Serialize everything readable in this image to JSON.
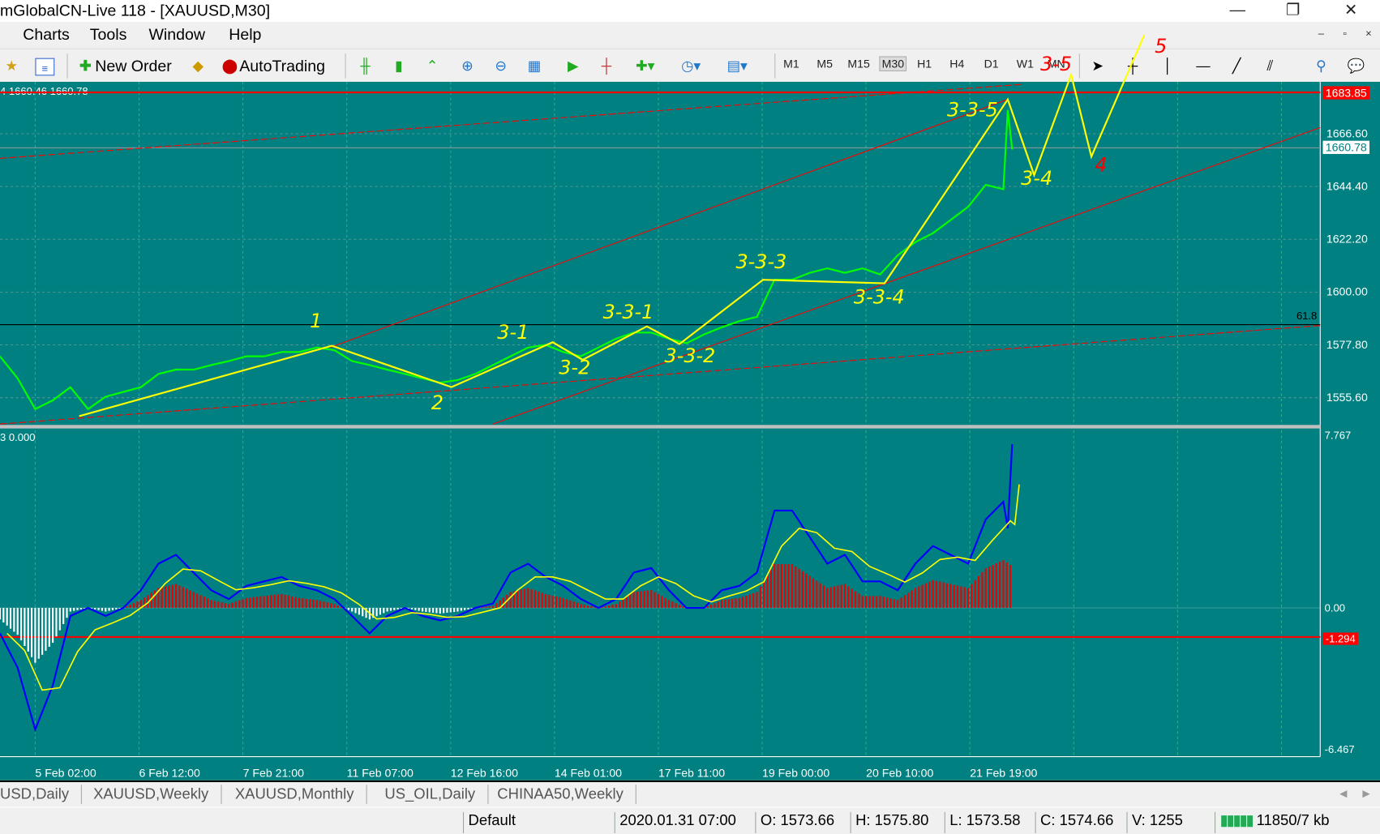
{
  "window": {
    "title": "mGlobalCN-Live 118 - [XAUUSD,M30]",
    "minimize": "—",
    "restore": "❐",
    "close": "✕"
  },
  "menu": [
    "Charts",
    "Tools",
    "Window",
    "Help"
  ],
  "mdi_buttons": [
    "–",
    "▫",
    "×"
  ],
  "toolbar": {
    "new_order": "New Order",
    "autotrading": "AutoTrading",
    "timeframes": [
      "M1",
      "M5",
      "M15",
      "M30",
      "H1",
      "H4",
      "D1",
      "W1",
      "MN"
    ],
    "active_timeframe": "M30"
  },
  "chart": {
    "info": "4 1660.46 1660.78",
    "price_axis": [
      "1666.60",
      "1644.40",
      "1622.20",
      "1600.00",
      "1577.80",
      "1555.60"
    ],
    "resistance_label": "1683.85",
    "bid_label": "1660.78",
    "fib_label": "61.8",
    "indicator_info": "3 0.000",
    "indicator_axis": {
      "top": "7.767",
      "zero": "0.00",
      "bottom": "-6.467",
      "level": "-1.294"
    },
    "time_axis": [
      "5 Feb 02:00",
      "6 Feb 12:00",
      "7 Feb 21:00",
      "11 Feb 07:00",
      "12 Feb 16:00",
      "14 Feb 01:00",
      "17 Feb 11:00",
      "19 Feb 00:00",
      "20 Feb 10:00",
      "21 Feb 19:00"
    ],
    "annotations": [
      "1",
      "2",
      "3-1",
      "3-2",
      "3-3-1",
      "3-3-2",
      "3-3-3",
      "3-3-4",
      "3-3-5",
      "3-4",
      "4",
      "5",
      "3-5"
    ],
    "colors": {
      "bg": "#008080",
      "price": "#00ff00",
      "wave": "#ffff00",
      "trend": "#ff0000",
      "macd": "#0000ff",
      "signal": "#ffff00"
    }
  },
  "chart_data": {
    "type": "line",
    "symbol": "XAUUSD",
    "timeframe": "M30",
    "price_series": [
      1573,
      1563.7,
      1550.8,
      1554.5,
      1560,
      1550.8,
      1556,
      1558,
      1560,
      1565.6,
      1567.4,
      1567.4,
      1569.3,
      1571,
      1573,
      1573,
      1574.8,
      1574.8,
      1576.7,
      1575.6,
      1571,
      1569.3,
      1567.4,
      1565.6,
      1563.7,
      1561.9,
      1563,
      1565.6,
      1569.3,
      1573,
      1576.7,
      1577.8,
      1574.8,
      1573,
      1576.7,
      1580.4,
      1583,
      1583,
      1580.4,
      1578.5,
      1582.2,
      1585.2,
      1587.8,
      1589.6,
      1605.2,
      1605.2,
      1608.1,
      1610,
      1608.1,
      1610,
      1607.4,
      1615.5,
      1621,
      1624.8,
      1630.3,
      1635.9,
      1645.1,
      1643.3,
      1676.6,
      1660
    ],
    "macd_series": [
      -1.15,
      -2.7,
      -5.5,
      -3.5,
      -0.36,
      0,
      -0.36,
      0,
      0.8,
      2.0,
      2.4,
      1.6,
      0.8,
      0.4,
      1.0,
      1.2,
      1.4,
      1.0,
      0.8,
      0.4,
      -0.36,
      -1.15,
      -0.36,
      0,
      -0.36,
      -0.56,
      -0.36,
      0,
      0.2,
      1.6,
      2.0,
      1.4,
      1.0,
      0.4,
      0,
      0.4,
      1.6,
      1.8,
      0.8,
      0,
      0,
      0.8,
      1.0,
      1.6,
      4.4,
      4.4,
      3.2,
      2.0,
      2.4,
      1.2,
      1.2,
      0.8,
      2.0,
      2.8,
      2.4,
      2.0,
      4.0,
      4.8,
      3.6,
      7.4
    ],
    "ylim_price": [
      1550,
      1690
    ],
    "ylim_macd": [
      -6.467,
      7.767
    ]
  },
  "tabs": [
    "USD,Daily",
    "XAUUSD,Weekly",
    "XAUUSD,Monthly",
    "US_OIL,Daily",
    "CHINAA50,Weekly"
  ],
  "status": {
    "profile": "Default",
    "time": "2020.01.31 07:00",
    "open": "O: 1573.66",
    "high": "H: 1575.80",
    "low": "L: 1573.58",
    "close": "C: 1574.66",
    "volume": "V: 1255",
    "traffic": "11850/7 kb"
  }
}
